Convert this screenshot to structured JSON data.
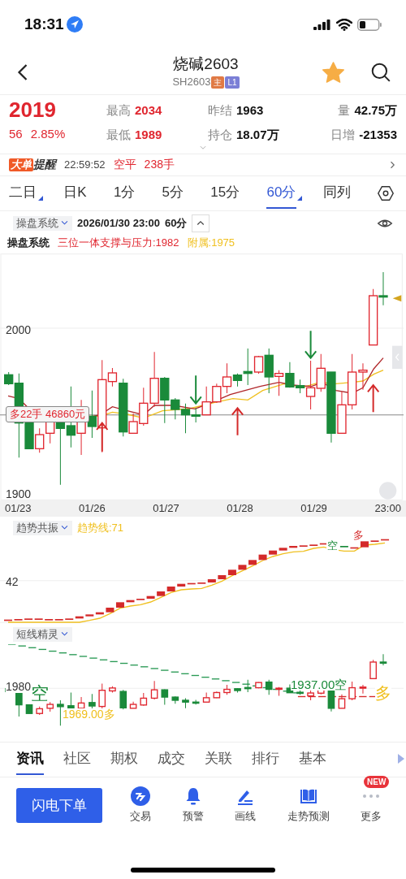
{
  "status_bar": {
    "time": "18:31"
  },
  "header": {
    "title": "烧碱2603",
    "code": "SH2603",
    "badges": [
      {
        "text": "主",
        "color": "#e07a45"
      },
      {
        "text": "L1",
        "color": "#7b7fd6"
      }
    ],
    "favorited": true
  },
  "quote": {
    "price": "2019",
    "change": "56",
    "change_pct": "2.85%",
    "stats": [
      {
        "label": "最高",
        "value": "2034",
        "color": "#e0262f"
      },
      {
        "label": "昨结",
        "value": "1963",
        "color": "#111111"
      },
      {
        "label": "量",
        "value": "42.75万",
        "color": "#111111"
      },
      {
        "label": "最低",
        "value": "1989",
        "color": "#e0262f"
      },
      {
        "label": "持仓",
        "value": "18.07万",
        "color": "#111111"
      },
      {
        "label": "日增",
        "value": "-21353",
        "color": "#111111"
      }
    ]
  },
  "alert": {
    "badge": "大单",
    "title": "提醒",
    "time": "22:59:52",
    "action": "空平",
    "volume": "238手"
  },
  "period_tabs": [
    {
      "label": "二日",
      "selected": false,
      "has_menu": true
    },
    {
      "label": "日K",
      "selected": false,
      "has_menu": false
    },
    {
      "label": "1分",
      "selected": false,
      "has_menu": false
    },
    {
      "label": "5分",
      "selected": false,
      "has_menu": false
    },
    {
      "label": "15分",
      "selected": false,
      "has_menu": false
    },
    {
      "label": "60分",
      "selected": true,
      "has_menu": true
    },
    {
      "label": "同列",
      "selected": false,
      "has_menu": false
    }
  ],
  "chart_header": {
    "indicator": "操盘系统",
    "datetime": "2026/01/30 23:00",
    "period": "60分"
  },
  "legend": {
    "name": "操盘系统",
    "items": [
      {
        "text": "三位一体支撑与压力:1982",
        "color": "#e0262f"
      },
      {
        "text": "附属:1975",
        "color": "#f0c020"
      }
    ]
  },
  "main_chart": {
    "y_labels": [
      "2000",
      "1900"
    ],
    "position_label": "多22手 46860元"
  },
  "x_axis": [
    "01/23",
    "01/26",
    "01/27",
    "01/28",
    "01/29",
    "23:00"
  ],
  "trend_panel": {
    "indicator": "趋势共振",
    "legend": "趋势线:71",
    "y_label": "42",
    "signals": [
      {
        "text": "空",
        "kind": "short"
      },
      {
        "text": "多",
        "kind": "long"
      }
    ]
  },
  "short_panel": {
    "indicator": "短线精灵",
    "y_label": "1980",
    "signals": [
      {
        "text": "空",
        "kind": "short"
      },
      {
        "text": "1969.00多",
        "kind": "long"
      },
      {
        "text": "1937.00空",
        "kind": "short"
      },
      {
        "text": "多",
        "kind": "long"
      }
    ]
  },
  "bottom_tabs": [
    {
      "label": "资讯",
      "selected": true
    },
    {
      "label": "社区",
      "selected": false
    },
    {
      "label": "期权",
      "selected": false
    },
    {
      "label": "成交",
      "selected": false
    },
    {
      "label": "关联",
      "selected": false
    },
    {
      "label": "排行",
      "selected": false
    },
    {
      "label": "基本",
      "selected": false
    }
  ],
  "quick_order": "闪电下单",
  "actions": [
    {
      "label": "交易"
    },
    {
      "label": "预警"
    },
    {
      "label": "画线"
    },
    {
      "label": "走势预测"
    },
    {
      "label": "更多",
      "badge": "NEW"
    }
  ]
}
